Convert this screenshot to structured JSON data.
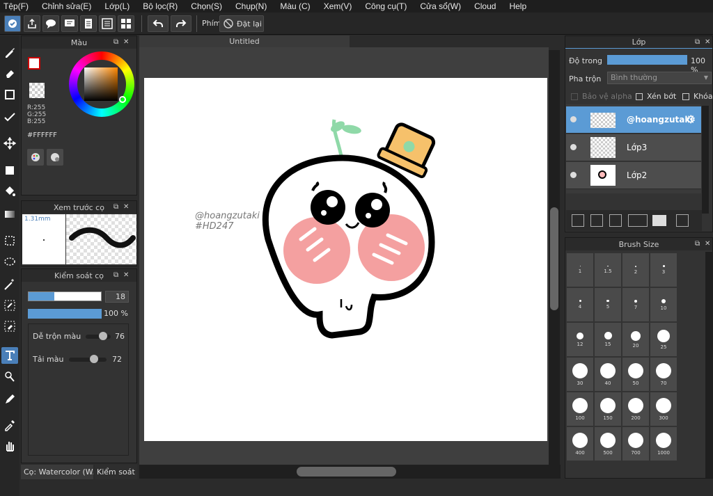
{
  "menu": [
    "Tệp(F)",
    "Chỉnh sửa(E)",
    "Lớp(L)",
    "Bộ lọc(R)",
    "Chọn(S)",
    "Chụp(N)",
    "Màu (C)",
    "Xem(V)",
    "Công cụ(T)",
    "Cửa sổ(W)",
    "Cloud",
    "Help"
  ],
  "toolbar": {
    "shortcut_label": "Phím",
    "reset_label": "Đặt lại"
  },
  "color_panel": {
    "title": "Màu",
    "r": "R:255",
    "g": "G:255",
    "b": "B:255",
    "hex": "#FFFFFF"
  },
  "brush_preview": {
    "title": "Xem trước cọ",
    "size": "1.31mm"
  },
  "brush_control": {
    "title": "Kiểm soát cọ",
    "size_value": "18",
    "opacity_value": "100 %",
    "blend_label": "Dễ trộn màu",
    "blend_value": "76",
    "resample_label": "Tải màu",
    "resample_value": "72"
  },
  "bottom_tabs": {
    "tab1": "Cọ: Watercolor (W...",
    "tab2": "Kiểm soát c"
  },
  "canvas": {
    "tab_title": "Untitled",
    "watermark_line1": "@hoangzutaki",
    "watermark_line2": "#HD247"
  },
  "layer_panel": {
    "title": "Lớp",
    "opacity_label": "Độ trong",
    "opacity_value": "100 %",
    "opacity_fraction": 1.0,
    "blend_label": "Pha trộn",
    "blend_value": "Bình thường",
    "protect_alpha": "Bảo vệ alpha",
    "clipping": "Xén bớt",
    "lock": "Khóa",
    "layers": [
      {
        "name": "@hoangzutaki",
        "selected": true
      },
      {
        "name": "Lớp3",
        "selected": false
      },
      {
        "name": "Lớp2",
        "selected": false
      }
    ]
  },
  "brush_size_panel": {
    "title": "Brush Size",
    "sizes": [
      "1",
      "1.5",
      "2",
      "3",
      "4",
      "5",
      "7",
      "10",
      "12",
      "15",
      "20",
      "25",
      "30",
      "40",
      "50",
      "70",
      "100",
      "150",
      "200",
      "300",
      "400",
      "500",
      "700",
      "1000"
    ]
  },
  "colors": {
    "accent": "#5b9bd5",
    "panel": "#333333",
    "cheek": "#f4a0a0",
    "hat": "#f6c16b",
    "sprout": "#8fd9a8"
  }
}
